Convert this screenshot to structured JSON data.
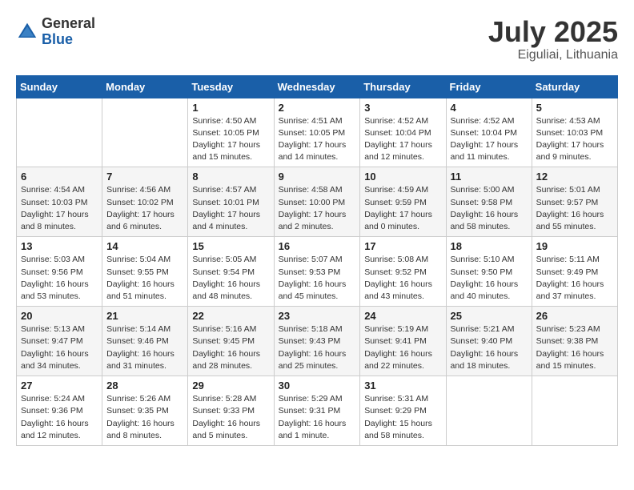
{
  "header": {
    "logo_general": "General",
    "logo_blue": "Blue",
    "month_year": "July 2025",
    "location": "Eiguliai, Lithuania"
  },
  "weekdays": [
    "Sunday",
    "Monday",
    "Tuesday",
    "Wednesday",
    "Thursday",
    "Friday",
    "Saturday"
  ],
  "weeks": [
    [
      {
        "day": "",
        "detail": ""
      },
      {
        "day": "",
        "detail": ""
      },
      {
        "day": "1",
        "detail": "Sunrise: 4:50 AM\nSunset: 10:05 PM\nDaylight: 17 hours\nand 15 minutes."
      },
      {
        "day": "2",
        "detail": "Sunrise: 4:51 AM\nSunset: 10:05 PM\nDaylight: 17 hours\nand 14 minutes."
      },
      {
        "day": "3",
        "detail": "Sunrise: 4:52 AM\nSunset: 10:04 PM\nDaylight: 17 hours\nand 12 minutes."
      },
      {
        "day": "4",
        "detail": "Sunrise: 4:52 AM\nSunset: 10:04 PM\nDaylight: 17 hours\nand 11 minutes."
      },
      {
        "day": "5",
        "detail": "Sunrise: 4:53 AM\nSunset: 10:03 PM\nDaylight: 17 hours\nand 9 minutes."
      }
    ],
    [
      {
        "day": "6",
        "detail": "Sunrise: 4:54 AM\nSunset: 10:03 PM\nDaylight: 17 hours\nand 8 minutes."
      },
      {
        "day": "7",
        "detail": "Sunrise: 4:56 AM\nSunset: 10:02 PM\nDaylight: 17 hours\nand 6 minutes."
      },
      {
        "day": "8",
        "detail": "Sunrise: 4:57 AM\nSunset: 10:01 PM\nDaylight: 17 hours\nand 4 minutes."
      },
      {
        "day": "9",
        "detail": "Sunrise: 4:58 AM\nSunset: 10:00 PM\nDaylight: 17 hours\nand 2 minutes."
      },
      {
        "day": "10",
        "detail": "Sunrise: 4:59 AM\nSunset: 9:59 PM\nDaylight: 17 hours\nand 0 minutes."
      },
      {
        "day": "11",
        "detail": "Sunrise: 5:00 AM\nSunset: 9:58 PM\nDaylight: 16 hours\nand 58 minutes."
      },
      {
        "day": "12",
        "detail": "Sunrise: 5:01 AM\nSunset: 9:57 PM\nDaylight: 16 hours\nand 55 minutes."
      }
    ],
    [
      {
        "day": "13",
        "detail": "Sunrise: 5:03 AM\nSunset: 9:56 PM\nDaylight: 16 hours\nand 53 minutes."
      },
      {
        "day": "14",
        "detail": "Sunrise: 5:04 AM\nSunset: 9:55 PM\nDaylight: 16 hours\nand 51 minutes."
      },
      {
        "day": "15",
        "detail": "Sunrise: 5:05 AM\nSunset: 9:54 PM\nDaylight: 16 hours\nand 48 minutes."
      },
      {
        "day": "16",
        "detail": "Sunrise: 5:07 AM\nSunset: 9:53 PM\nDaylight: 16 hours\nand 45 minutes."
      },
      {
        "day": "17",
        "detail": "Sunrise: 5:08 AM\nSunset: 9:52 PM\nDaylight: 16 hours\nand 43 minutes."
      },
      {
        "day": "18",
        "detail": "Sunrise: 5:10 AM\nSunset: 9:50 PM\nDaylight: 16 hours\nand 40 minutes."
      },
      {
        "day": "19",
        "detail": "Sunrise: 5:11 AM\nSunset: 9:49 PM\nDaylight: 16 hours\nand 37 minutes."
      }
    ],
    [
      {
        "day": "20",
        "detail": "Sunrise: 5:13 AM\nSunset: 9:47 PM\nDaylight: 16 hours\nand 34 minutes."
      },
      {
        "day": "21",
        "detail": "Sunrise: 5:14 AM\nSunset: 9:46 PM\nDaylight: 16 hours\nand 31 minutes."
      },
      {
        "day": "22",
        "detail": "Sunrise: 5:16 AM\nSunset: 9:45 PM\nDaylight: 16 hours\nand 28 minutes."
      },
      {
        "day": "23",
        "detail": "Sunrise: 5:18 AM\nSunset: 9:43 PM\nDaylight: 16 hours\nand 25 minutes."
      },
      {
        "day": "24",
        "detail": "Sunrise: 5:19 AM\nSunset: 9:41 PM\nDaylight: 16 hours\nand 22 minutes."
      },
      {
        "day": "25",
        "detail": "Sunrise: 5:21 AM\nSunset: 9:40 PM\nDaylight: 16 hours\nand 18 minutes."
      },
      {
        "day": "26",
        "detail": "Sunrise: 5:23 AM\nSunset: 9:38 PM\nDaylight: 16 hours\nand 15 minutes."
      }
    ],
    [
      {
        "day": "27",
        "detail": "Sunrise: 5:24 AM\nSunset: 9:36 PM\nDaylight: 16 hours\nand 12 minutes."
      },
      {
        "day": "28",
        "detail": "Sunrise: 5:26 AM\nSunset: 9:35 PM\nDaylight: 16 hours\nand 8 minutes."
      },
      {
        "day": "29",
        "detail": "Sunrise: 5:28 AM\nSunset: 9:33 PM\nDaylight: 16 hours\nand 5 minutes."
      },
      {
        "day": "30",
        "detail": "Sunrise: 5:29 AM\nSunset: 9:31 PM\nDaylight: 16 hours\nand 1 minute."
      },
      {
        "day": "31",
        "detail": "Sunrise: 5:31 AM\nSunset: 9:29 PM\nDaylight: 15 hours\nand 58 minutes."
      },
      {
        "day": "",
        "detail": ""
      },
      {
        "day": "",
        "detail": ""
      }
    ]
  ]
}
